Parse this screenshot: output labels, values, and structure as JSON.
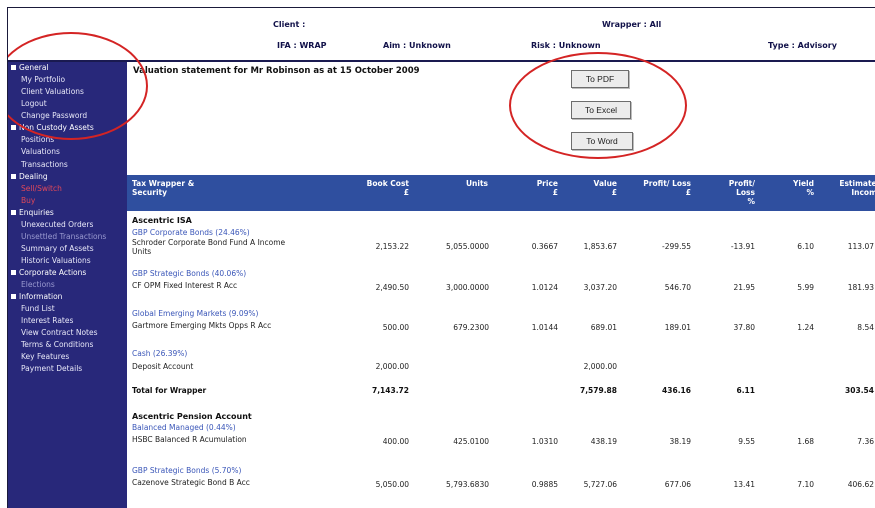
{
  "header": {
    "client_label": "Client :",
    "wrapper_label": "Wrapper : All",
    "ifa_label": "IFA : WRAP",
    "aim_label": "Aim : Unknown",
    "risk_label": "Risk : Unknown",
    "type_label": "Type : Advisory"
  },
  "sidebar": {
    "general": {
      "label": "General",
      "items": [
        "My Portfolio",
        "Client Valuations",
        "Logout",
        "Change Password"
      ]
    },
    "non_custody": {
      "label": "Non Custody Assets",
      "items": [
        "Positions",
        "Valuations",
        "Transactions"
      ]
    },
    "dealing": {
      "label": "Dealing",
      "items": [
        "Sell/Switch",
        "Buy"
      ]
    },
    "enquiries": {
      "label": "Enquiries",
      "items": [
        "Unexecuted Orders",
        "Unsettled Transactions",
        "Summary of Assets",
        "Historic Valuations"
      ]
    },
    "corporate": {
      "label": "Corporate Actions",
      "items": [
        "Elections"
      ]
    },
    "information": {
      "label": "Information",
      "items": [
        "Fund List",
        "Interest Rates",
        "View Contract Notes",
        "Terms & Conditions",
        "Key Features",
        "Payment Details"
      ]
    }
  },
  "main": {
    "title": "Valuation statement for Mr Robinson as at 15 October 2009",
    "buttons": {
      "pdf": "To PDF",
      "excel": "To Excel",
      "word": "To Word"
    }
  },
  "table": {
    "headers": {
      "security_1": "Tax Wrapper &",
      "security_2": "Security",
      "bookcost_1": "Book Cost",
      "bookcost_2": "£",
      "units": "Units",
      "price_1": "Price",
      "price_2": "£",
      "value_1": "Value",
      "value_2": "£",
      "pl_1": "Profit/ Loss",
      "pl_2": "£",
      "plpct_1": "Profit/",
      "plpct_2": "Loss",
      "plpct_3": "%",
      "yield_1": "Yield",
      "yield_2": "%",
      "income_1": "Estimated",
      "income_2": "Income"
    },
    "isa": {
      "title": "Ascentric ISA",
      "groups": [
        {
          "category": "GBP Corporate Bonds (24.46%)",
          "security": "Schroder Corporate Bond Fund A Income",
          "security2": "Units",
          "book_cost": "2,153.22",
          "units": "5,055.0000",
          "price": "0.3667",
          "value": "1,853.67",
          "pl": "-299.55",
          "pl_pct": "-13.91",
          "yield": "6.10",
          "income": "113.07"
        },
        {
          "category": "GBP Strategic Bonds (40.06%)",
          "security": "CF OPM Fixed Interest R Acc",
          "security2": "",
          "book_cost": "2,490.50",
          "units": "3,000.0000",
          "price": "1.0124",
          "value": "3,037.20",
          "pl": "546.70",
          "pl_pct": "21.95",
          "yield": "5.99",
          "income": "181.93"
        },
        {
          "category": "Global Emerging Markets (9.09%)",
          "security": "Gartmore Emerging Mkts Opps R Acc",
          "security2": "",
          "book_cost": "500.00",
          "units": "679.2300",
          "price": "1.0144",
          "value": "689.01",
          "pl": "189.01",
          "pl_pct": "37.80",
          "yield": "1.24",
          "income": "8.54"
        },
        {
          "category": "Cash (26.39%)",
          "security": "Deposit Account",
          "security2": "",
          "book_cost": "2,000.00",
          "units": "",
          "price": "",
          "value": "2,000.00",
          "pl": "",
          "pl_pct": "",
          "yield": "",
          "income": ""
        }
      ],
      "total": {
        "label": "Total for Wrapper",
        "book_cost": "7,143.72",
        "value": "7,579.88",
        "pl": "436.16",
        "pl_pct": "6.11",
        "income": "303.54"
      }
    },
    "pension": {
      "title": "Ascentric Pension Account",
      "groups": [
        {
          "category": "Balanced Managed (0.44%)",
          "security": "HSBC Balanced R Acumulation",
          "security2": "",
          "book_cost": "400.00",
          "units": "425.0100",
          "price": "1.0310",
          "value": "438.19",
          "pl": "38.19",
          "pl_pct": "9.55",
          "yield": "1.68",
          "income": "7.36"
        },
        {
          "category": "GBP Strategic Bonds (5.70%)",
          "security": "Cazenove Strategic Bond B Acc",
          "security2": "",
          "book_cost": "5,050.00",
          "units": "5,793.6830",
          "price": "0.9885",
          "value": "5,727.06",
          "pl": "677.06",
          "pl_pct": "13.41",
          "yield": "7.10",
          "income": "406.62"
        }
      ]
    }
  }
}
